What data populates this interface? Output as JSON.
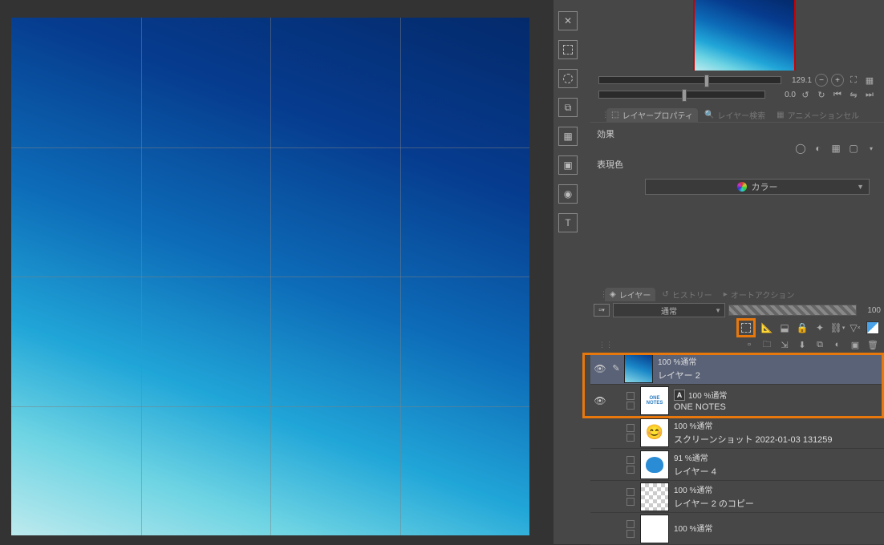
{
  "canvas": {
    "grid_divisions": 4
  },
  "navigator": {
    "zoom_value": "129.1",
    "rotate_value": "0.0"
  },
  "property_tabs": {
    "layer_property": "レイヤープロパティ",
    "layer_search": "レイヤー検索",
    "animation_cel": "アニメーションセル"
  },
  "layer_property": {
    "effect_label": "効果",
    "color_label": "表現色",
    "color_mode": "カラー"
  },
  "layer_tabs": {
    "layer": "レイヤー",
    "history": "ヒストリー",
    "auto_action": "オートアクション"
  },
  "layer_controls": {
    "blend_mode": "通常",
    "opacity": "100"
  },
  "layers": [
    {
      "opacity_mode": "100 %通常",
      "name": "レイヤー 2",
      "thumb": "gradient",
      "visible": true,
      "selected": true,
      "editable": true,
      "text_badge": false
    },
    {
      "opacity_mode": "100 %通常",
      "name": "ONE NOTES",
      "thumb": "text",
      "thumb_text": "ONE NOTES",
      "visible": true,
      "selected": false,
      "editable": false,
      "text_badge": true
    },
    {
      "opacity_mode": "100 %通常",
      "name": "スクリーンショット 2022-01-03 131259",
      "thumb": "smile",
      "visible": false,
      "selected": false,
      "editable": false,
      "text_badge": false
    },
    {
      "opacity_mode": "91 %通常",
      "name": "レイヤー 4",
      "thumb": "slime",
      "visible": false,
      "selected": false,
      "editable": false,
      "text_badge": false
    },
    {
      "opacity_mode": "100 %通常",
      "name": "レイヤー 2 のコピー",
      "thumb": "checker",
      "visible": false,
      "selected": false,
      "editable": false,
      "text_badge": false
    },
    {
      "opacity_mode": "100 %通常",
      "name": "",
      "thumb": "white",
      "visible": false,
      "selected": false,
      "editable": false,
      "text_badge": false
    }
  ]
}
